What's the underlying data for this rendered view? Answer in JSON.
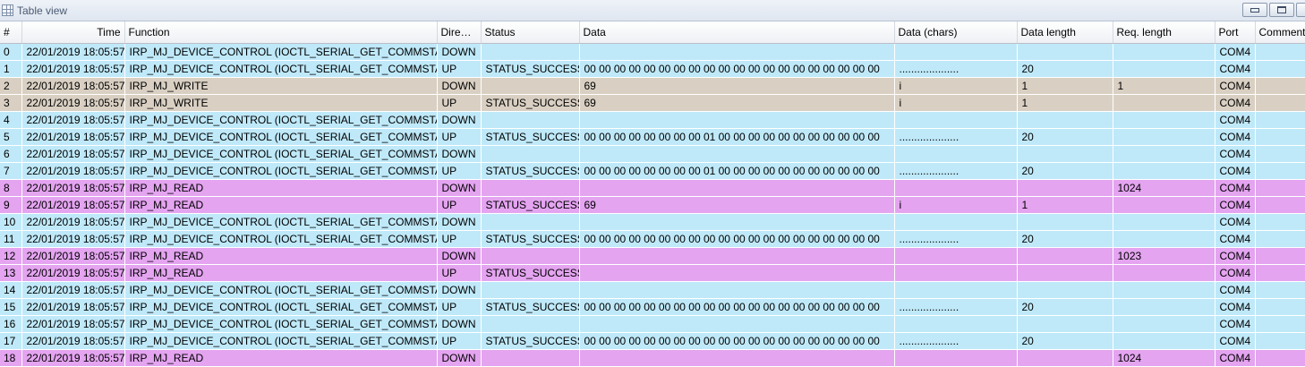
{
  "window": {
    "title": "Table view"
  },
  "columns": [
    "#",
    "Time",
    "Function",
    "Direct...",
    "Status",
    "Data",
    "Data (chars)",
    "Data length",
    "Req. length",
    "Port",
    "Comments"
  ],
  "row_colors": {
    "c": "#bfe9f9",
    "w": "#d9d0c3",
    "r": "#e4a4f0"
  },
  "rows": [
    {
      "t": "c",
      "cells": [
        "0",
        "22/01/2019 18:05:57",
        "IRP_MJ_DEVICE_CONTROL (IOCTL_SERIAL_GET_COMMSTATUS)",
        "DOWN",
        "",
        "",
        "",
        "",
        "",
        "COM4",
        ""
      ]
    },
    {
      "t": "c",
      "cells": [
        "1",
        "22/01/2019 18:05:57",
        "IRP_MJ_DEVICE_CONTROL (IOCTL_SERIAL_GET_COMMSTATUS)",
        "UP",
        "STATUS_SUCCESS",
        "00 00 00 00 00 00 00 00 00 00 00 00 00 00 00 00 00 00 00 00",
        "....................",
        "20",
        "",
        "COM4",
        ""
      ]
    },
    {
      "t": "w",
      "cells": [
        "2",
        "22/01/2019 18:05:57",
        "IRP_MJ_WRITE",
        "DOWN",
        "",
        "69",
        "i",
        "1",
        "1",
        "COM4",
        ""
      ]
    },
    {
      "t": "w",
      "cells": [
        "3",
        "22/01/2019 18:05:57",
        "IRP_MJ_WRITE",
        "UP",
        "STATUS_SUCCESS",
        "69",
        "i",
        "1",
        "",
        "COM4",
        ""
      ]
    },
    {
      "t": "c",
      "cells": [
        "4",
        "22/01/2019 18:05:57",
        "IRP_MJ_DEVICE_CONTROL (IOCTL_SERIAL_GET_COMMSTATUS)",
        "DOWN",
        "",
        "",
        "",
        "",
        "",
        "COM4",
        ""
      ]
    },
    {
      "t": "c",
      "cells": [
        "5",
        "22/01/2019 18:05:57",
        "IRP_MJ_DEVICE_CONTROL (IOCTL_SERIAL_GET_COMMSTATUS)",
        "UP",
        "STATUS_SUCCESS",
        "00 00 00 00 00 00 00 00 01 00 00 00 00 00 00 00 00 00 00 00",
        "....................",
        "20",
        "",
        "COM4",
        ""
      ]
    },
    {
      "t": "c",
      "cells": [
        "6",
        "22/01/2019 18:05:57",
        "IRP_MJ_DEVICE_CONTROL (IOCTL_SERIAL_GET_COMMSTATUS)",
        "DOWN",
        "",
        "",
        "",
        "",
        "",
        "COM4",
        ""
      ]
    },
    {
      "t": "c",
      "cells": [
        "7",
        "22/01/2019 18:05:57",
        "IRP_MJ_DEVICE_CONTROL (IOCTL_SERIAL_GET_COMMSTATUS)",
        "UP",
        "STATUS_SUCCESS",
        "00 00 00 00 00 00 00 00 01 00 00 00 00 00 00 00 00 00 00 00",
        "....................",
        "20",
        "",
        "COM4",
        ""
      ]
    },
    {
      "t": "r",
      "cells": [
        "8",
        "22/01/2019 18:05:57",
        "IRP_MJ_READ",
        "DOWN",
        "",
        "",
        "",
        "",
        "1024",
        "COM4",
        ""
      ]
    },
    {
      "t": "r",
      "cells": [
        "9",
        "22/01/2019 18:05:57",
        "IRP_MJ_READ",
        "UP",
        "STATUS_SUCCESS",
        "69",
        "i",
        "1",
        "",
        "COM4",
        ""
      ]
    },
    {
      "t": "c",
      "cells": [
        "10",
        "22/01/2019 18:05:57",
        "IRP_MJ_DEVICE_CONTROL (IOCTL_SERIAL_GET_COMMSTATUS)",
        "DOWN",
        "",
        "",
        "",
        "",
        "",
        "COM4",
        ""
      ]
    },
    {
      "t": "c",
      "cells": [
        "11",
        "22/01/2019 18:05:57",
        "IRP_MJ_DEVICE_CONTROL (IOCTL_SERIAL_GET_COMMSTATUS)",
        "UP",
        "STATUS_SUCCESS",
        "00 00 00 00 00 00 00 00 00 00 00 00 00 00 00 00 00 00 00 00",
        "....................",
        "20",
        "",
        "COM4",
        ""
      ]
    },
    {
      "t": "r",
      "cells": [
        "12",
        "22/01/2019 18:05:57",
        "IRP_MJ_READ",
        "DOWN",
        "",
        "",
        "",
        "",
        "1023",
        "COM4",
        ""
      ]
    },
    {
      "t": "r",
      "cells": [
        "13",
        "22/01/2019 18:05:57",
        "IRP_MJ_READ",
        "UP",
        "STATUS_SUCCESS",
        "",
        "",
        "",
        "",
        "COM4",
        ""
      ]
    },
    {
      "t": "c",
      "cells": [
        "14",
        "22/01/2019 18:05:57",
        "IRP_MJ_DEVICE_CONTROL (IOCTL_SERIAL_GET_COMMSTATUS)",
        "DOWN",
        "",
        "",
        "",
        "",
        "",
        "COM4",
        ""
      ]
    },
    {
      "t": "c",
      "cells": [
        "15",
        "22/01/2019 18:05:57",
        "IRP_MJ_DEVICE_CONTROL (IOCTL_SERIAL_GET_COMMSTATUS)",
        "UP",
        "STATUS_SUCCESS",
        "00 00 00 00 00 00 00 00 00 00 00 00 00 00 00 00 00 00 00 00",
        "....................",
        "20",
        "",
        "COM4",
        ""
      ]
    },
    {
      "t": "c",
      "cells": [
        "16",
        "22/01/2019 18:05:57",
        "IRP_MJ_DEVICE_CONTROL (IOCTL_SERIAL_GET_COMMSTATUS)",
        "DOWN",
        "",
        "",
        "",
        "",
        "",
        "COM4",
        ""
      ]
    },
    {
      "t": "c",
      "cells": [
        "17",
        "22/01/2019 18:05:57",
        "IRP_MJ_DEVICE_CONTROL (IOCTL_SERIAL_GET_COMMSTATUS)",
        "UP",
        "STATUS_SUCCESS",
        "00 00 00 00 00 00 00 00 00 00 00 00 00 00 00 00 00 00 00 00",
        "....................",
        "20",
        "",
        "COM4",
        ""
      ]
    },
    {
      "t": "r",
      "cells": [
        "18",
        "22/01/2019 18:05:57",
        "IRP_MJ_READ",
        "DOWN",
        "",
        "",
        "",
        "",
        "1024",
        "COM4",
        ""
      ]
    }
  ]
}
